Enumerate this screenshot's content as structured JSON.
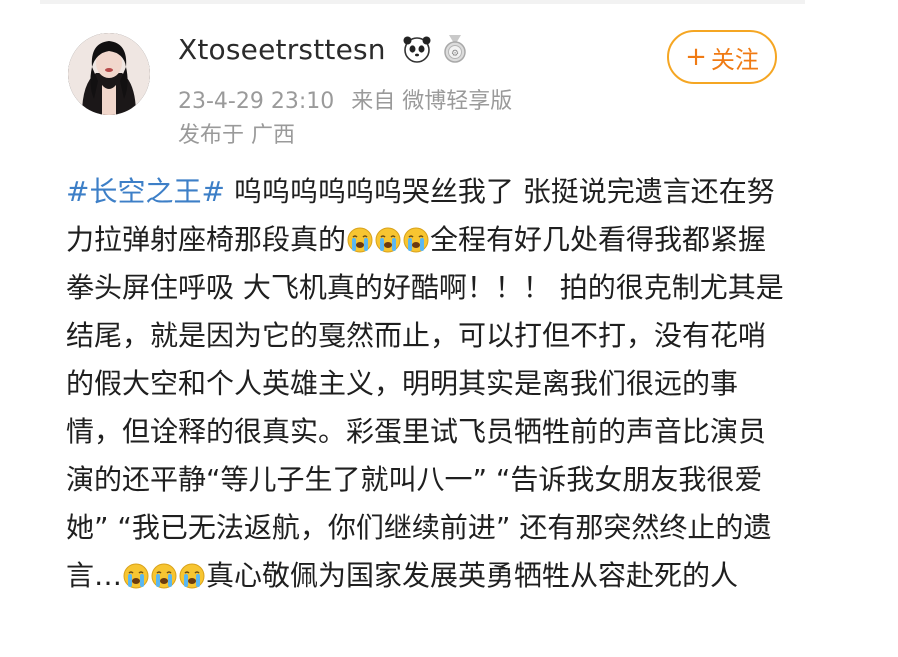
{
  "colors": {
    "accent_orange": "#f07b14",
    "follow_border": "#f5a623",
    "hashtag_blue": "#3d7fc7",
    "meta_gray": "#9a9a9a"
  },
  "post": {
    "username": "Xtoseetrsttesn",
    "badges": [
      "panda-icon",
      "medal-icon"
    ],
    "timestamp": "23-4-29 23:10",
    "source": "来自 微博轻享版",
    "location": "发布于 广西",
    "follow_label": "关注",
    "follow_plus": "+",
    "hashtag": "#长空之王#",
    "text_1": " 呜呜呜呜呜呜哭丝我了 张挺说完遗言还在努力拉弹射座椅那段真的",
    "emoji_name": "crying-face-icon",
    "text_2": "全程有好几处看得我都紧握拳头屏住呼吸 大飞机真的好酷啊！！！ 拍的很克制尤其是结尾，就是因为它的戛然而止，可以打但不打，没有花哨的假大空和个人英雄主义，明明其实是离我们很远的事情，但诠释的很真实。彩蛋里试飞员牺牲前的声音比演员演的还平静“等儿子生了就叫八一” “告诉我女朋友我很爱她” “我已无法返航，你们继续前进” 还有那突然终止的遗言…",
    "text_3": "真心敬佩为国家发展英勇牺牲从容赴死的人"
  }
}
